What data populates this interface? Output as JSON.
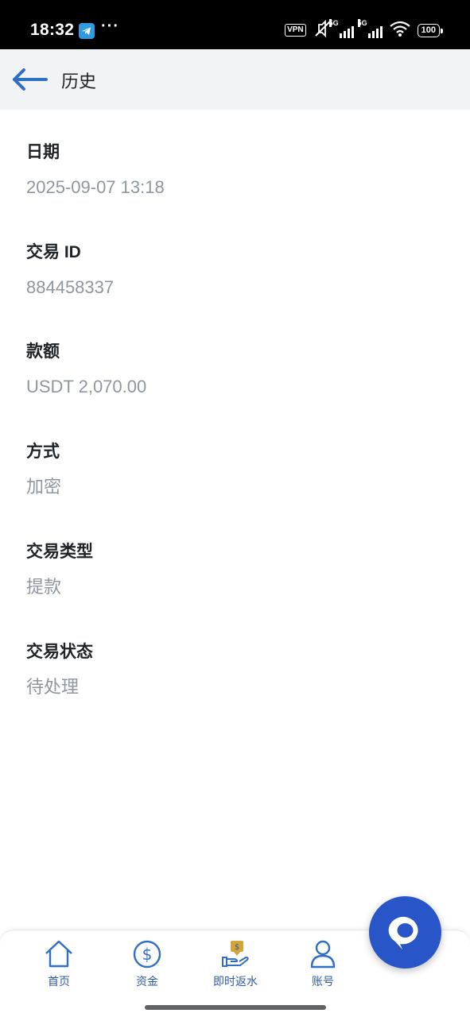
{
  "status_bar": {
    "time": "18:32",
    "ellipsis": "···",
    "vpn": "VPN",
    "net1": "5G",
    "net2": "5G",
    "battery": "100"
  },
  "header": {
    "title": "历史",
    "back_icon": "arrow-left-icon"
  },
  "details": {
    "date": {
      "label": "日期",
      "value": "2025-09-07 13:18"
    },
    "transaction_id": {
      "label": "交易 ID",
      "value": "884458337"
    },
    "amount": {
      "label": "款额",
      "value": "USDT 2,070.00"
    },
    "method": {
      "label": "方式",
      "value": "加密"
    },
    "type": {
      "label": "交易类型",
      "value": "提款"
    },
    "status": {
      "label": "交易状态",
      "value": "待处理"
    }
  },
  "bottom_nav": {
    "items": [
      {
        "label": "首页",
        "icon": "home-icon"
      },
      {
        "label": "资金",
        "icon": "dollar-circle-icon"
      },
      {
        "label": "即时返水",
        "icon": "cashback-icon"
      },
      {
        "label": "账号",
        "icon": "user-icon"
      }
    ]
  },
  "colors": {
    "accent": "#2856c8",
    "nav_text": "#2f5aa5",
    "label": "#1f2328",
    "value": "#8e97a0",
    "header_bg": "#f2f3f5"
  }
}
